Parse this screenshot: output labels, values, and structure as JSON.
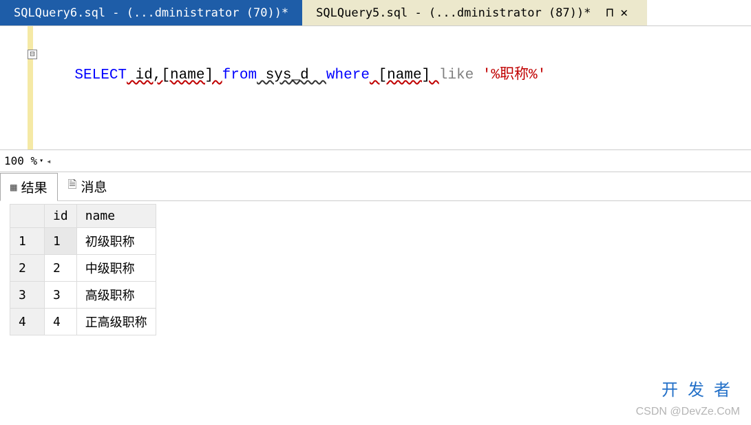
{
  "tabs": {
    "active": "SQLQuery6.sql - (...dministrator (70))*",
    "inactive": "SQLQuery5.sql - (...dministrator (87))*"
  },
  "editor": {
    "sql": {
      "select": "SELECT",
      "cols": " id,[name] ",
      "from": "from",
      "table": " sys_d  ",
      "where": "where",
      "col2": " [name] ",
      "like": "like",
      "str": " '%职称%'"
    }
  },
  "zoom": "100 %",
  "result_tabs": {
    "results": "结果",
    "messages": "消息"
  },
  "grid": {
    "headers": [
      "id",
      "name"
    ],
    "rows": [
      {
        "n": "1",
        "id": "1",
        "name": "初级职称"
      },
      {
        "n": "2",
        "id": "2",
        "name": "中级职称"
      },
      {
        "n": "3",
        "id": "3",
        "name": "高级职称"
      },
      {
        "n": "4",
        "id": "4",
        "name": "正高级职称"
      }
    ]
  },
  "watermarks": {
    "top": "开发者",
    "bottom": "CSDN @DevZe.CoM"
  },
  "icons": {
    "pin": "⊓",
    "close": "✕",
    "collapse": "⊟",
    "dropdown": "▾",
    "scrollleft": "◂",
    "table": "▦",
    "page": "🗎"
  }
}
